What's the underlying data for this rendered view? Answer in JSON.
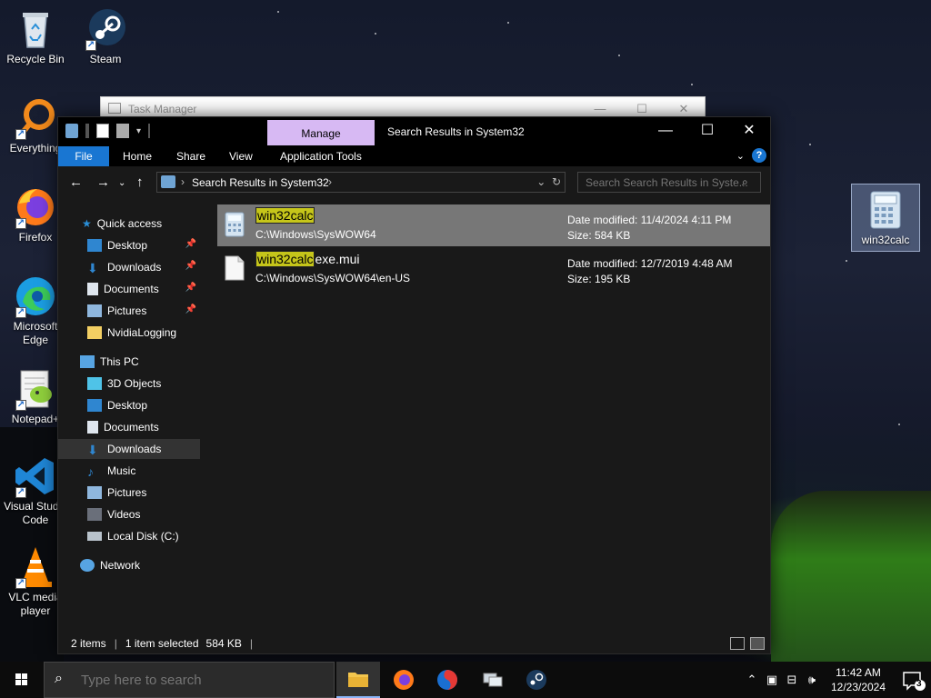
{
  "desktop": {
    "icons": [
      {
        "label": "Recycle Bin",
        "icon": "recycle-bin-icon"
      },
      {
        "label": "Steam",
        "icon": "steam-icon"
      },
      {
        "label": "Everything",
        "icon": "everything-icon"
      },
      {
        "label": "Firefox",
        "icon": "firefox-icon"
      },
      {
        "label": "Microsoft Edge",
        "icon": "edge-icon"
      },
      {
        "label": "Notepad+",
        "icon": "notepad-plus-icon"
      },
      {
        "label": "Visual Studio Code",
        "icon": "vscode-icon"
      },
      {
        "label": "VLC media player",
        "icon": "vlc-icon"
      },
      {
        "label": "win32calc",
        "icon": "calculator-icon"
      }
    ]
  },
  "task_manager": {
    "title": "Task Manager"
  },
  "explorer": {
    "title": "Search Results in System32",
    "manage_tab": "Manage",
    "ribbon_tabs": [
      "File",
      "Home",
      "Share",
      "View",
      "Application Tools"
    ],
    "address_path": "Search Results in System32",
    "search_placeholder": "Search Search Results in Syste...",
    "sidebar": {
      "quick_access": "Quick access",
      "quick_items": [
        "Desktop",
        "Downloads",
        "Documents",
        "Pictures",
        "NvidiaLogging"
      ],
      "this_pc": "This PC",
      "pc_items": [
        "3D Objects",
        "Desktop",
        "Documents",
        "Downloads",
        "Music",
        "Pictures",
        "Videos",
        "Local Disk (C:)"
      ],
      "network": "Network"
    },
    "results": [
      {
        "name_highlight": "win32calc",
        "name_rest": "",
        "path": "C:\\Windows\\SysWOW64",
        "date": "Date modified: 11/4/2024 4:11 PM",
        "size": "Size: 584 KB"
      },
      {
        "name_highlight": "win32calc",
        "name_rest": "exe.mui",
        "path": "C:\\Windows\\SysWOW64\\en-US",
        "date": "Date modified: 12/7/2019 4:48 AM",
        "size": "Size: 195 KB"
      }
    ],
    "status": {
      "items": "2 items",
      "selected": "1 item selected",
      "size": "584 KB"
    }
  },
  "taskbar": {
    "search_placeholder": "Type here to search",
    "apps": [
      "file-explorer-icon",
      "firefox-icon",
      "app-icon",
      "network-app-icon",
      "steam-icon"
    ],
    "time": "11:42 AM",
    "date": "12/23/2024",
    "notification_count": "3"
  },
  "colors": {
    "accent": "#1976d2",
    "manage_tab": "#d7b9f3",
    "highlight": "#c5c51a"
  }
}
